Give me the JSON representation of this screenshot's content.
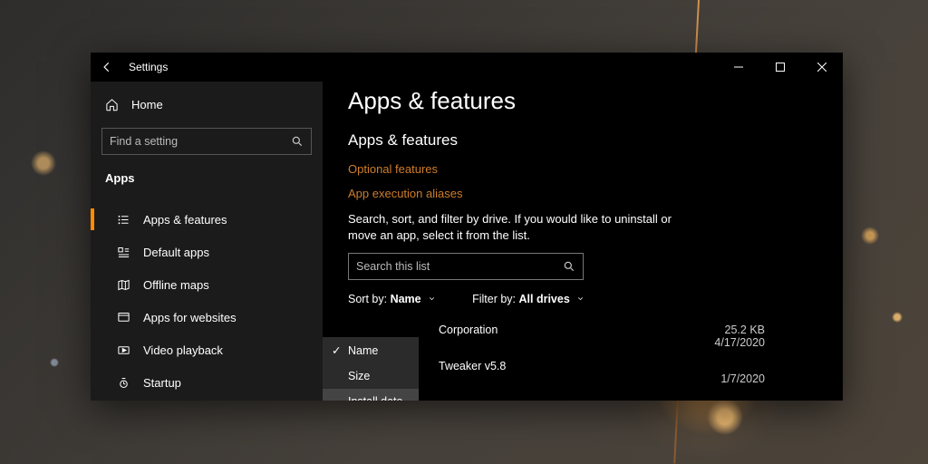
{
  "window": {
    "title": "Settings"
  },
  "sidebar": {
    "home_label": "Home",
    "search_placeholder": "Find a setting",
    "section_label": "Apps",
    "items": [
      {
        "label": "Apps & features"
      },
      {
        "label": "Default apps"
      },
      {
        "label": "Offline maps"
      },
      {
        "label": "Apps for websites"
      },
      {
        "label": "Video playback"
      },
      {
        "label": "Startup"
      }
    ]
  },
  "main": {
    "page_title": "Apps & features",
    "sub_title": "Apps & features",
    "links": {
      "optional": "Optional features",
      "aliases": "App execution aliases"
    },
    "description": "Search, sort, and filter by drive. If you would like to uninstall or move an app, select it from the list.",
    "list_search_placeholder": "Search this list",
    "sort_label": "Sort by:",
    "sort_value": "Name",
    "filter_label": "Filter by:",
    "filter_value": "All drives",
    "apps": [
      {
        "name_fragment": "Corporation",
        "size": "25.2 KB",
        "date": "4/17/2020"
      },
      {
        "name_fragment": "Tweaker v5.8",
        "size": "",
        "date": "1/7/2020"
      }
    ],
    "sort_dropdown": {
      "options": [
        {
          "label": "Name",
          "selected": true
        },
        {
          "label": "Size",
          "selected": false
        },
        {
          "label": "Install date",
          "selected": false,
          "hover": true
        }
      ]
    }
  }
}
